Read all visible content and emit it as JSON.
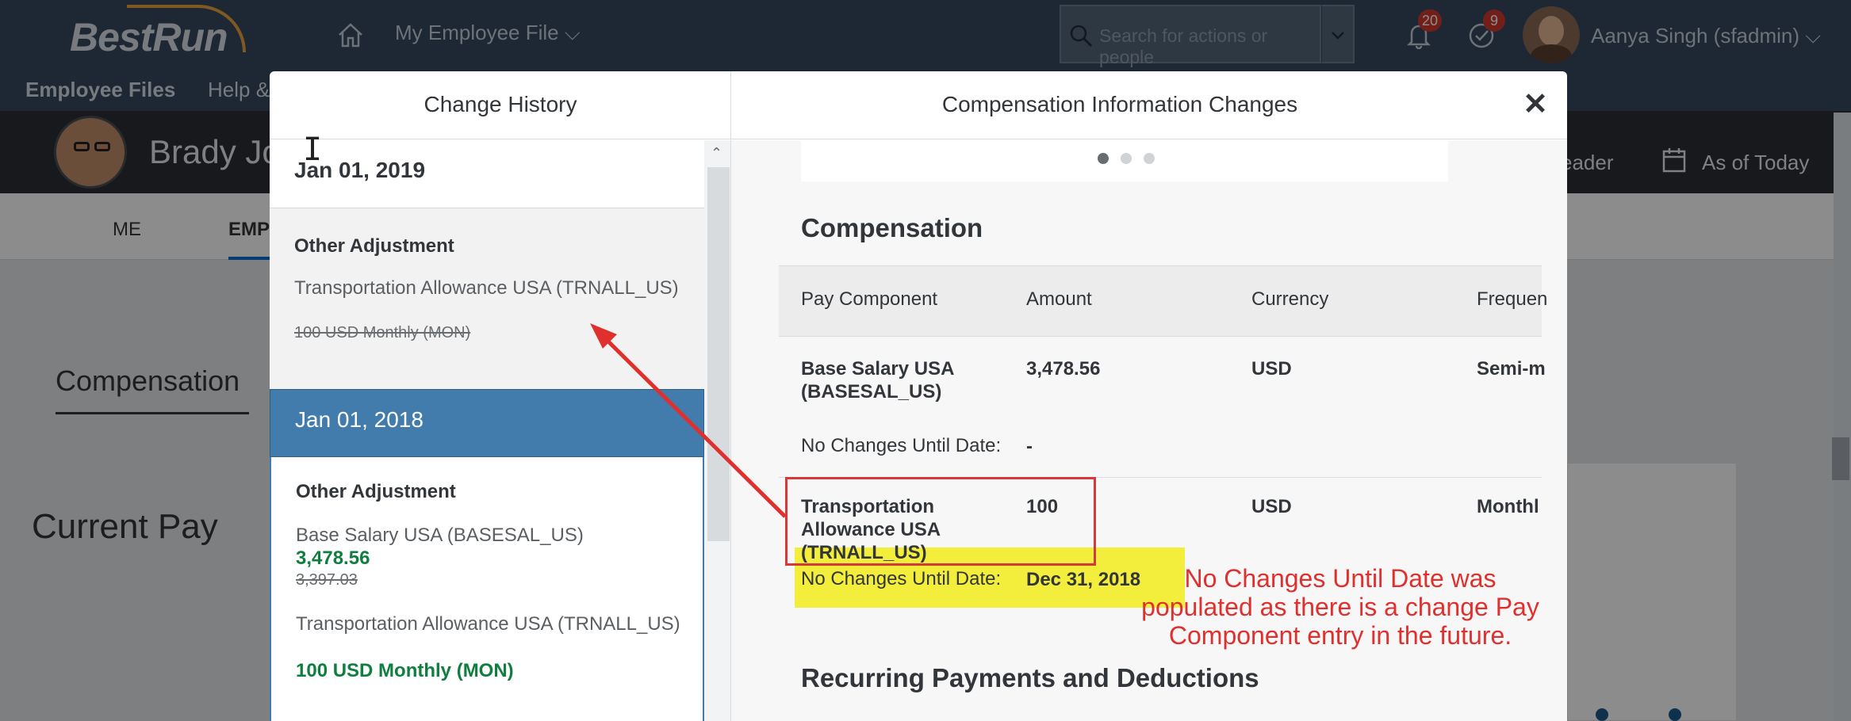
{
  "shell": {
    "logo": "BestRun",
    "file_menu": "My Employee File ⌵",
    "search_placeholder": "Search for actions or people",
    "notifications_count": "20",
    "tasks_count": "9",
    "user_name": "Aanya Singh (sfadmin) ⌵",
    "subnav": [
      "Employee Files",
      "Help &"
    ]
  },
  "employee": {
    "name": "Brady Jo",
    "right_label1": "eader",
    "right_label2": "As of Today",
    "tabs": [
      "ME",
      "EMP"
    ]
  },
  "background": {
    "compensation_heading": "Compensation",
    "current_pay_heading": "Current Pay"
  },
  "dialog": {
    "left_title": "Change History",
    "right_title": "Compensation Information Changes",
    "close_label": "✕",
    "history": [
      {
        "date": "Jan 01, 2019",
        "title": "Other Adjustment",
        "entries": [
          {
            "name": "Transportation Allowance USA (TRNALL_US)",
            "old": "100 USD Monthly (MON)"
          }
        ]
      },
      {
        "date": "Jan 01, 2018",
        "title": "Other Adjustment",
        "entries": [
          {
            "name": "Base Salary USA (BASESAL_US)",
            "new": "3,478.56",
            "old": "3,397.03"
          },
          {
            "name": "Transportation Allowance USA (TRNALL_US)",
            "new": "100 USD Monthly (MON)"
          }
        ]
      }
    ],
    "section_compensation": "Compensation",
    "columns": [
      "Pay Component",
      "Amount",
      "Currency",
      "Frequen"
    ],
    "rows": [
      {
        "component": "Base Salary USA (BASESAL_US)",
        "amount": "3,478.56",
        "currency": "USD",
        "frequency": "Semi-m",
        "until_label": "No Changes Until Date:",
        "until_value": "-"
      },
      {
        "component": "Transportation Allowance USA (TRNALL_US)",
        "amount": "100",
        "currency": "USD",
        "frequency": "Monthl",
        "until_label": "No Changes Until Date:",
        "until_value": "Dec 31, 2018"
      }
    ],
    "section_recurring": "Recurring Payments and Deductions"
  },
  "annotation": {
    "note": "No Changes Until Date was populated as there is a change Pay Component entry in the future.",
    "color": "#e0302e"
  }
}
